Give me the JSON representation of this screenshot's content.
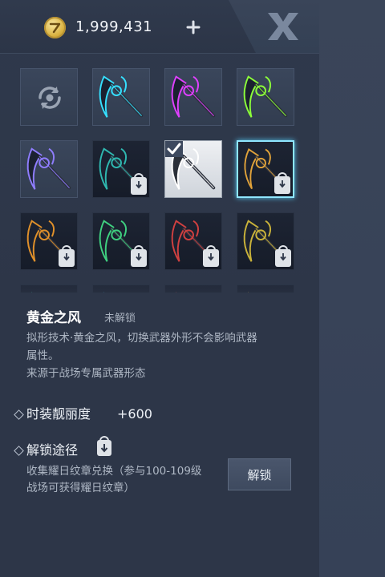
{
  "header": {
    "currency_amount": "1,999,431",
    "currency_icon": "gold-coin-icon",
    "add_icon": "plus-icon",
    "close_icon": "close-x-icon"
  },
  "grid": {
    "cells": [
      {
        "id": "reset",
        "icon": "reset-icon",
        "locked": false,
        "equipped": false,
        "selected": false,
        "accent": "#9aa4b3"
      },
      {
        "id": "cyan-scythe",
        "icon": "scythe-icon",
        "locked": false,
        "equipped": false,
        "selected": false,
        "accent": "#35e0ff"
      },
      {
        "id": "magenta-scythe",
        "icon": "scythe-icon",
        "locked": false,
        "equipped": false,
        "selected": false,
        "accent": "#e040ff"
      },
      {
        "id": "green-scythe",
        "icon": "scythe-icon",
        "locked": false,
        "equipped": false,
        "selected": false,
        "accent": "#8cff3a"
      },
      {
        "id": "violet-blade",
        "icon": "scythe-icon",
        "locked": false,
        "equipped": false,
        "selected": false,
        "accent": "#8f7dff"
      },
      {
        "id": "teal-dark-scythe",
        "icon": "scythe-icon",
        "locked": true,
        "equipped": false,
        "selected": false,
        "accent": "#2fb8b0"
      },
      {
        "id": "white-scythe",
        "icon": "scythe-icon",
        "locked": false,
        "equipped": true,
        "selected": false,
        "accent": "#ffffff"
      },
      {
        "id": "gold-teal-scythe",
        "icon": "scythe-icon",
        "locked": true,
        "equipped": false,
        "selected": true,
        "accent": "#e0a23a"
      },
      {
        "id": "orange-orb-scythe",
        "icon": "scythe-icon",
        "locked": true,
        "equipped": false,
        "selected": false,
        "accent": "#e0902a"
      },
      {
        "id": "green-orb-scythe",
        "icon": "scythe-icon",
        "locked": true,
        "equipped": false,
        "selected": false,
        "accent": "#3fd080"
      },
      {
        "id": "red-scythe",
        "icon": "scythe-icon",
        "locked": true,
        "equipped": false,
        "selected": false,
        "accent": "#d04040"
      },
      {
        "id": "olive-scythe",
        "icon": "scythe-icon",
        "locked": true,
        "equipped": false,
        "selected": false,
        "accent": "#c9b23a"
      },
      {
        "id": "partial-1",
        "icon": "scythe-icon",
        "locked": true,
        "equipped": false,
        "selected": false,
        "accent": "#3fbfa0"
      },
      {
        "id": "partial-2",
        "icon": "scythe-icon",
        "locked": true,
        "equipped": false,
        "selected": false,
        "accent": "#3fa0bf"
      },
      {
        "id": "partial-3",
        "icon": "scythe-icon",
        "locked": true,
        "equipped": false,
        "selected": false,
        "accent": "#d05050"
      },
      {
        "id": "partial-4",
        "icon": "scythe-icon",
        "locked": true,
        "equipped": false,
        "selected": false,
        "accent": "#c0a040"
      }
    ]
  },
  "detail": {
    "title": "黄金之风",
    "status": "未解锁",
    "description_line1": "拟形技术·黄金之风，切换武器外形不会影响武器",
    "description_line2": "属性。",
    "description_line3": "来源于战场专属武器形态",
    "stat_label": "时装靓丽度",
    "stat_value": "+600",
    "unlock_label": "解锁途径",
    "unlock_desc_line1": "收集耀日纹章兑换（参与100-109级",
    "unlock_desc_line2": "战场可获得耀日纹章）",
    "unlock_button": "解锁"
  },
  "colors": {
    "panel_bg": "#2d3648",
    "selected_border": "#8fe6ff",
    "text_primary": "#eef2f7",
    "text_secondary": "#aeb7c4"
  }
}
